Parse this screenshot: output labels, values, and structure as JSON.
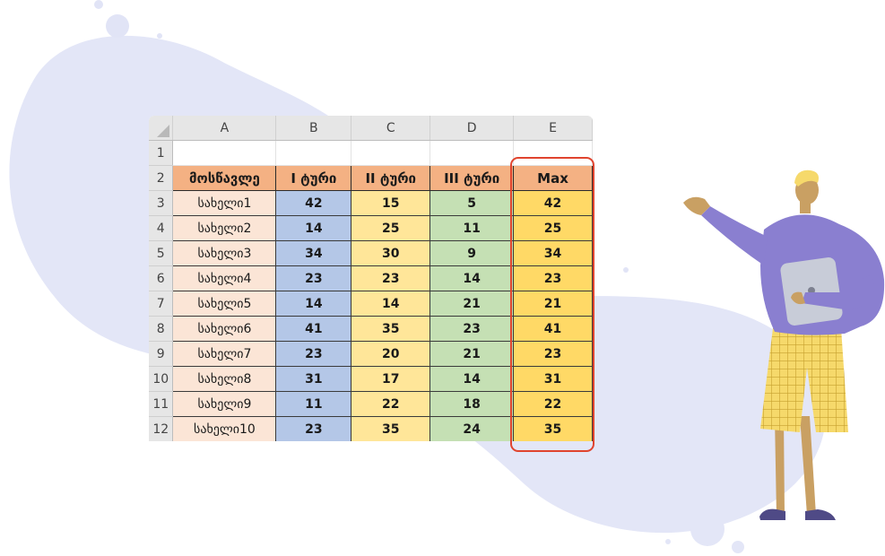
{
  "spreadsheet": {
    "column_headers": [
      "A",
      "B",
      "C",
      "D",
      "E"
    ],
    "row_numbers": [
      "1",
      "2",
      "3",
      "4",
      "5",
      "6",
      "7",
      "8",
      "9",
      "10",
      "11",
      "12"
    ],
    "header_row": [
      "მოსწავლე",
      "I ტური",
      "II ტური",
      "III ტური",
      "Max"
    ],
    "rows": [
      {
        "name": "სახელი1",
        "b": "42",
        "c": "15",
        "d": "5",
        "e": "42"
      },
      {
        "name": "სახელი2",
        "b": "14",
        "c": "25",
        "d": "11",
        "e": "25"
      },
      {
        "name": "სახელი3",
        "b": "34",
        "c": "30",
        "d": "9",
        "e": "34"
      },
      {
        "name": "სახელი4",
        "b": "23",
        "c": "23",
        "d": "14",
        "e": "23"
      },
      {
        "name": "სახელი5",
        "b": "14",
        "c": "14",
        "d": "21",
        "e": "21"
      },
      {
        "name": "სახელი6",
        "b": "41",
        "c": "35",
        "d": "23",
        "e": "41"
      },
      {
        "name": "სახელი7",
        "b": "23",
        "c": "20",
        "d": "21",
        "e": "23"
      },
      {
        "name": "სახელი8",
        "b": "31",
        "c": "17",
        "d": "14",
        "e": "31"
      },
      {
        "name": "სახელი9",
        "b": "11",
        "c": "22",
        "d": "18",
        "e": "22"
      },
      {
        "name": "სახელი10",
        "b": "23",
        "c": "35",
        "d": "24",
        "e": "35"
      }
    ]
  },
  "colors": {
    "header_fill": "#f4b183",
    "name_fill": "#fbe5d6",
    "col_b_fill": "#b4c7e7",
    "col_c_fill": "#ffe699",
    "col_d_fill": "#c5e0b4",
    "col_e_fill": "#ffd966",
    "highlight_outline": "#e0442e",
    "background_blob": "#e3e6f7",
    "sweater": "#8a7fd0"
  },
  "icons": {
    "select_all": "select-all-triangle-icon"
  }
}
